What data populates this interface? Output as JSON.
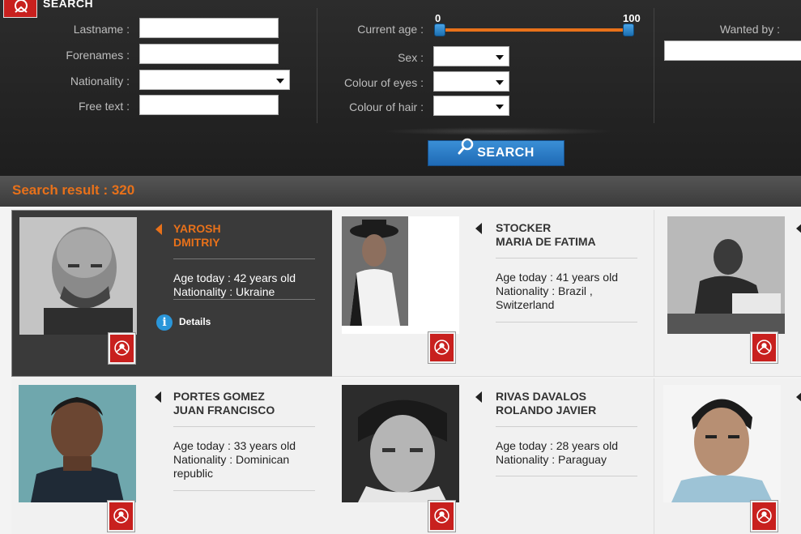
{
  "search": {
    "title": "SEARCH",
    "lastname_label": "Lastname :",
    "forenames_label": "Forenames :",
    "nationality_label": "Nationality :",
    "free_text_label": "Free text :",
    "current_age_label": "Current age :",
    "age_min": "0",
    "age_max": "100",
    "age_range": [
      0,
      100
    ],
    "sex_label": "Sex :",
    "eyes_label": "Colour of eyes :",
    "hair_label": "Colour of hair :",
    "wanted_by_label": "Wanted by :",
    "button_label": "SEARCH"
  },
  "results": {
    "count_text": "Search result : 320",
    "details_label": "Details",
    "cards": [
      {
        "name1": "YAROSH",
        "name2": "DMITRIY",
        "age": "Age today : 42 years old",
        "nat1": "Nationality : Ukraine",
        "nat2": "",
        "photo": "grayscale-portrait",
        "active": true
      },
      {
        "name1": "STOCKER",
        "name2": "MARIA DE FATIMA",
        "age": "Age today : 41 years old",
        "nat1": "Nationality : Brazil ,",
        "nat2": "Switzerland",
        "photo": "hat-portrait"
      },
      {
        "name1": "",
        "name2": "",
        "age": "",
        "nat1": "",
        "nat2": "",
        "photo": "sitting-photo"
      },
      {
        "name1": "PORTES GOMEZ",
        "name2": "JUAN FRANCISCO",
        "age": "Age today : 33 years old",
        "nat1": "Nationality : Dominican",
        "nat2": "republic",
        "photo": "mugshot-teal"
      },
      {
        "name1": "RIVAS DAVALOS",
        "name2": "ROLANDO JAVIER",
        "age": "Age today : 28 years old",
        "nat1": "Nationality : Paraguay",
        "nat2": "",
        "photo": "grayscale-face"
      },
      {
        "name1": "",
        "name2": "",
        "age": "",
        "nat1": "",
        "nat2": "",
        "photo": "mugshot-white"
      }
    ]
  },
  "colors": {
    "accent": "#e8711a",
    "brand_red": "#c8201e",
    "button_blue": "#2a7cc7"
  }
}
